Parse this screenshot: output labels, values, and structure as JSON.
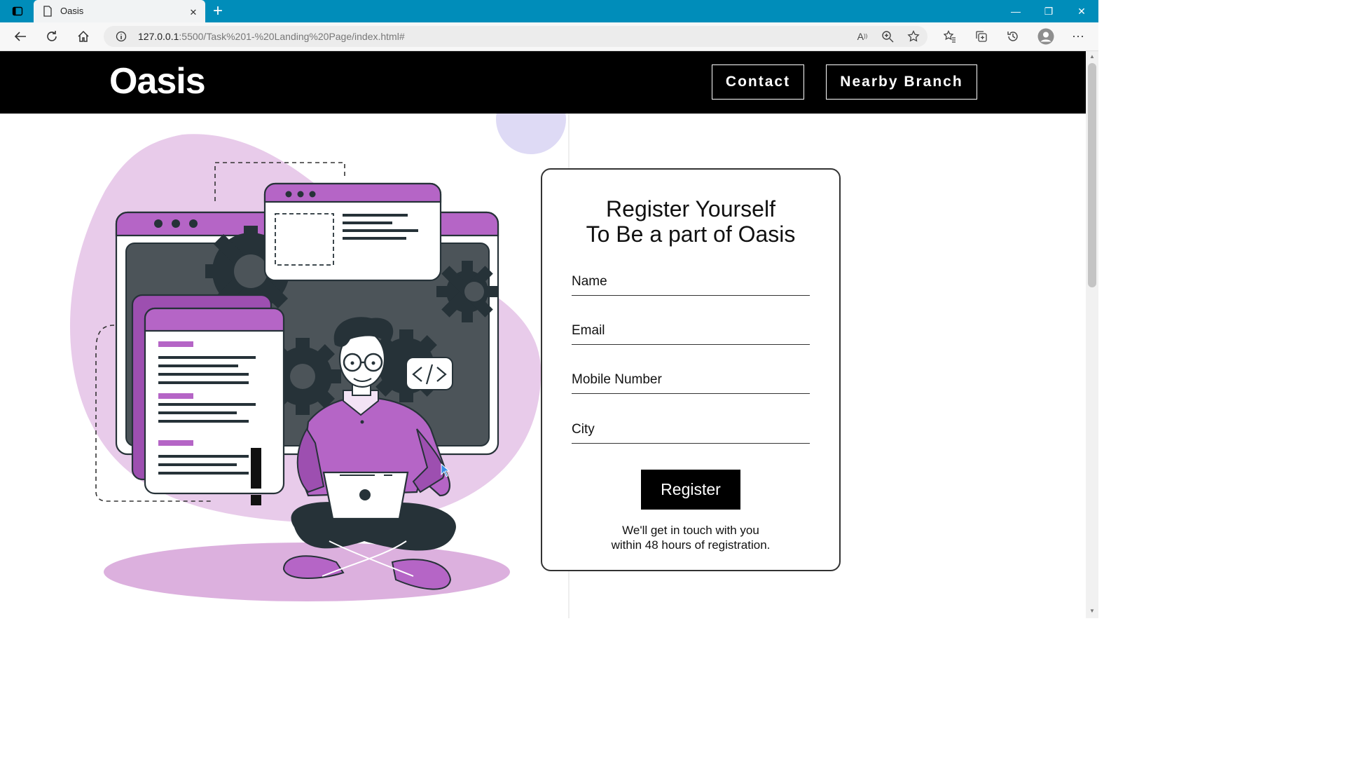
{
  "browser": {
    "tab_title": "Oasis",
    "url_host": "127.0.0.1",
    "url_path": ":5500/Task%201-%20Landing%20Page/index.html#",
    "tab_close": "✕",
    "new_tab": "+",
    "minimize": "—",
    "restore": "❐",
    "close": "✕"
  },
  "navbar": {
    "logo": "Oasis",
    "links": [
      "Contact",
      "Nearby Branch"
    ]
  },
  "form": {
    "heading_line1": "Register Yourself",
    "heading_line2": "To Be a part of Oasis",
    "fields": [
      {
        "placeholder": "Name"
      },
      {
        "placeholder": "Email"
      },
      {
        "placeholder": "Mobile Number"
      },
      {
        "placeholder": "City"
      }
    ],
    "button_label": "Register",
    "note_line1": "We'll get in touch with you",
    "note_line2": "within 48 hours of registration."
  },
  "colors": {
    "tabbar": "#008dba",
    "accent_purple": "#b565c6",
    "light_purple": "#e8cbea"
  }
}
